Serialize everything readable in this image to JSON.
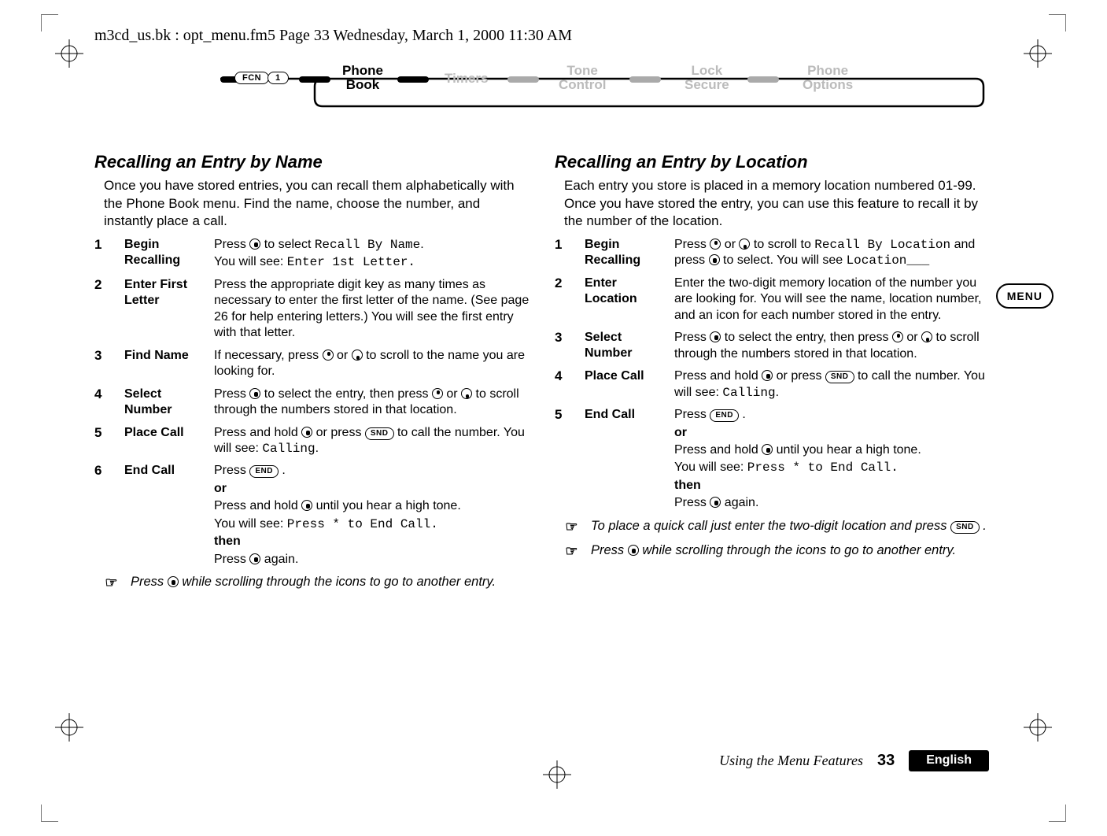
{
  "runningHeader": "m3cd_us.bk : opt_menu.fm5  Page 33  Wednesday, March 1, 2000  11:30 AM",
  "flow": {
    "fcn": "FCN",
    "one": "1",
    "phoneBook": "Phone\nBook",
    "timers": "Timers",
    "tone": "Tone\nControl",
    "lock": "Lock\nSecure",
    "options": "Phone\nOptions"
  },
  "sideTab": "MENU",
  "left": {
    "title": "Recalling an Entry by Name",
    "intro": "Once you have stored entries, you can recall them alphabetically with the Phone Book menu. Find the name, choose the number, and instantly place a call.",
    "steps": {
      "s1": {
        "label": "Begin Recalling",
        "l1a": "Press ",
        "l1b": " to select ",
        "l1c": "Recall By Name",
        "l1d": ".",
        "l2a": "You will see: ",
        "l2b": "Enter 1st Letter."
      },
      "s2": {
        "label": "Enter First Letter",
        "body": "Press the appropriate digit key as many times as necessary to enter the first letter of the name. (See page 26 for help entering letters.) You will see the first entry with that letter."
      },
      "s3": {
        "label": "Find Name",
        "a": "If necessary, press ",
        "b": " or ",
        "c": " to scroll to the name you are looking for."
      },
      "s4": {
        "label": "Select Number",
        "a": "Press ",
        "b": " to select the entry, then press ",
        "c": " or ",
        "d": " to scroll through the numbers stored in that location."
      },
      "s5": {
        "label": "Place Call",
        "a": "Press and hold ",
        "b": " or press ",
        "snd": "SND",
        "c": " to call the number. You will see: ",
        "d": "Calling",
        "e": "."
      },
      "s6": {
        "label": "End Call",
        "press": "Press ",
        "end": "END",
        "dot": ".",
        "or": "or",
        "holdA": "Press and hold ",
        "holdB": " until you hear a high tone.",
        "seeA": "You will see: ",
        "seeB": "Press * to End Call.",
        "then": "then",
        "againA": "Press ",
        "againB": " again."
      }
    },
    "noteA": "Press ",
    "noteB": " while scrolling through the icons to go to another entry."
  },
  "right": {
    "title": "Recalling an Entry by Location",
    "intro": "Each entry you store is placed in a memory location numbered 01-99. Once you have stored the entry, you can use this feature to recall it by the number of the location.",
    "steps": {
      "s1": {
        "label": "Begin Recalling",
        "a": "Press ",
        "b": " or ",
        "c": " to scroll to ",
        "d": "Recall By Location",
        "e": " and press ",
        "f": " to select. You will see ",
        "g": "Location___"
      },
      "s2": {
        "label": "Enter Location",
        "body": "Enter the two-digit memory location of the number you are looking for. You will see the name, location number, and an icon for each number stored in the entry."
      },
      "s3": {
        "label": "Select Number",
        "a": "Press ",
        "b": " to select the entry, then press ",
        "c": " or ",
        "d": " to scroll through the numbers stored in that location."
      },
      "s4": {
        "label": "Place Call",
        "a": "Press and hold ",
        "b": " or press ",
        "snd": "SND",
        "c": " to call the number. You will see: ",
        "d": "Calling",
        "e": "."
      },
      "s5": {
        "label": "End Call",
        "press": "Press ",
        "end": "END",
        "dot": ".",
        "or": "or",
        "holdA": "Press and hold ",
        "holdB": " until you hear a high tone.",
        "seeA": "You will see: ",
        "seeB": "Press * to End Call.",
        "then": "then",
        "againA": "Press ",
        "againB": " again."
      }
    },
    "note1a": "To place a quick call just enter the two-digit location and press ",
    "note1b": ".",
    "note1snd": "SND",
    "note2a": "Press ",
    "note2b": " while scrolling through the icons to go to another entry."
  },
  "footer": {
    "title": "Using the Menu Features",
    "page": "33",
    "lang": "English"
  }
}
